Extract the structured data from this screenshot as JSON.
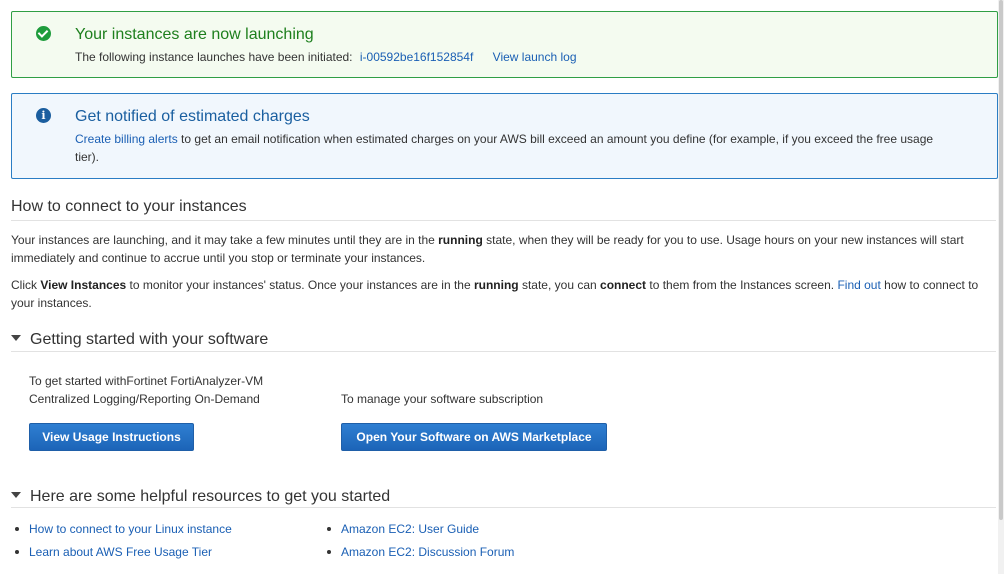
{
  "success_alert": {
    "title": "Your instances are now launching",
    "body_prefix": "The following instance launches have been initiated:",
    "instance_id": "i-00592be16f152854f",
    "launch_log_link": "View launch log"
  },
  "info_alert": {
    "title": "Get notified of estimated charges",
    "billing_link": "Create billing alerts",
    "body_text": " to get an email notification when estimated charges on your AWS bill exceed an amount you define (for example, if you exceed the free usage tier)."
  },
  "connect_section": {
    "heading": "How to connect to your instances",
    "para1_a": "Your instances are launching, and it may take a few minutes until they are in the ",
    "para1_bold": "running",
    "para1_b": " state, when they will be ready for you to use. Usage hours on your new instances will start immediately and continue to accrue until you stop or terminate your instances.",
    "para2_a": "Click ",
    "para2_bold1": "View Instances",
    "para2_b": " to monitor your instances' status. Once your instances are in the ",
    "para2_bold2": "running",
    "para2_c": " state, you can ",
    "para2_bold3": "connect",
    "para2_d": " to them from the Instances screen. ",
    "para2_link": "Find out",
    "para2_e": " how to connect to your instances."
  },
  "software_section": {
    "heading": "Getting started with your software",
    "left_line1": "To get started withFortinet FortiAnalyzer-VM",
    "left_line2": "Centralized Logging/Reporting On-Demand",
    "right_text": "To manage your software subscription",
    "usage_button": "View Usage Instructions",
    "marketplace_button": "Open Your Software on AWS Marketplace"
  },
  "resources_section": {
    "heading": "Here are some helpful resources to get you started",
    "left_links": [
      "How to connect to your Linux instance",
      "Learn about AWS Free Usage Tier"
    ],
    "right_links": [
      "Amazon EC2: User Guide",
      "Amazon EC2: Discussion Forum"
    ]
  }
}
